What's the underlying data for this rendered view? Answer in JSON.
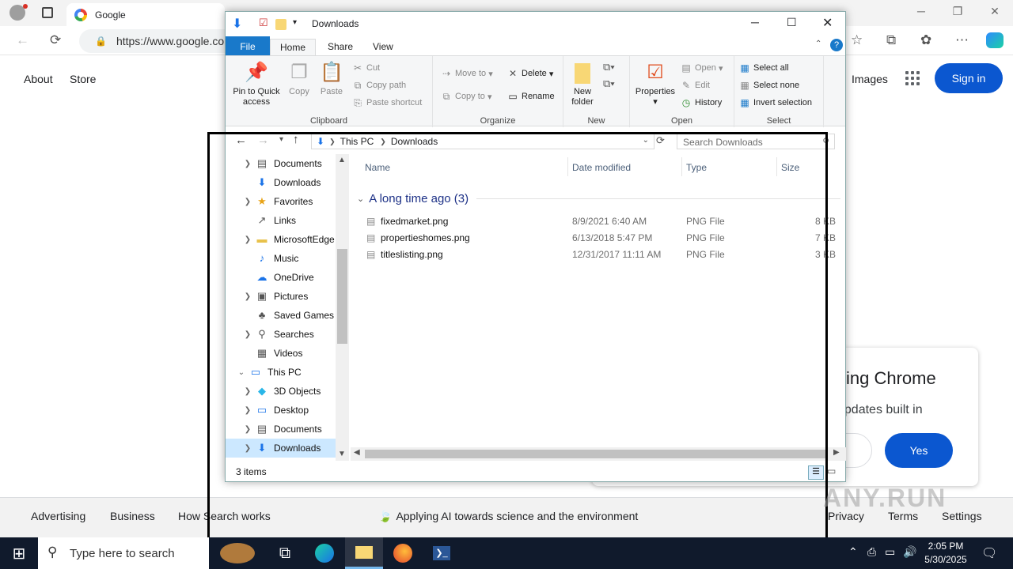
{
  "browser": {
    "tab_title": "Google",
    "address": "https://www.google.co",
    "colors": {
      "accent": "#0b57d0"
    }
  },
  "google": {
    "about": "About",
    "store": "Store",
    "images": "Images",
    "sign_in": "Sign in",
    "footer": {
      "advertising": "Advertising",
      "business": "Business",
      "how_search_works": "How Search works",
      "ai_note": "Applying AI towards science and the environment",
      "privacy": "Privacy",
      "terms": "Terms",
      "settings": "Settings"
    },
    "popup": {
      "heading": "sing Chrome",
      "sub": "updates built in",
      "yes": "Yes"
    }
  },
  "explorer": {
    "title": "Downloads",
    "ribbon_tabs": [
      "File",
      "Home",
      "Share",
      "View"
    ],
    "clipboard": {
      "pin": "Pin to Quick access",
      "copy": "Copy",
      "paste": "Paste",
      "cut": "Cut",
      "copy_path": "Copy path",
      "paste_shortcut": "Paste shortcut",
      "label": "Clipboard"
    },
    "organize": {
      "move_to": "Move to",
      "copy_to": "Copy to",
      "delete": "Delete",
      "rename": "Rename",
      "label": "Organize"
    },
    "new": {
      "new_folder": "New folder",
      "label": "New"
    },
    "open": {
      "properties": "Properties",
      "open": "Open",
      "edit": "Edit",
      "history": "History",
      "label": "Open"
    },
    "select": {
      "select_all": "Select all",
      "select_none": "Select none",
      "invert": "Invert selection",
      "label": "Select"
    },
    "breadcrumb": [
      "This PC",
      "Downloads"
    ],
    "search_placeholder": "Search Downloads",
    "nav_items": [
      {
        "label": "Documents",
        "icon": "document-icon",
        "chevron": true,
        "indent": 1
      },
      {
        "label": "Downloads",
        "icon": "download-icon",
        "chevron": false,
        "indent": 1
      },
      {
        "label": "Favorites",
        "icon": "star-icon",
        "chevron": true,
        "indent": 1
      },
      {
        "label": "Links",
        "icon": "link-icon",
        "chevron": false,
        "indent": 1
      },
      {
        "label": "MicrosoftEdge",
        "icon": "folder-icon",
        "chevron": true,
        "indent": 1
      },
      {
        "label": "Music",
        "icon": "music-icon",
        "chevron": false,
        "indent": 1
      },
      {
        "label": "OneDrive",
        "icon": "cloud-icon",
        "chevron": false,
        "indent": 1
      },
      {
        "label": "Pictures",
        "icon": "picture-icon",
        "chevron": true,
        "indent": 1
      },
      {
        "label": "Saved Games",
        "icon": "game-icon",
        "chevron": false,
        "indent": 1
      },
      {
        "label": "Searches",
        "icon": "search-icon",
        "chevron": true,
        "indent": 1
      },
      {
        "label": "Videos",
        "icon": "video-icon",
        "chevron": false,
        "indent": 1
      },
      {
        "label": "This PC",
        "icon": "computer-icon",
        "chevron": true,
        "indent": 0,
        "expanded": true
      },
      {
        "label": "3D Objects",
        "icon": "cube-icon",
        "chevron": true,
        "indent": 1
      },
      {
        "label": "Desktop",
        "icon": "desktop-icon",
        "chevron": true,
        "indent": 1
      },
      {
        "label": "Documents",
        "icon": "document-icon",
        "chevron": true,
        "indent": 1
      },
      {
        "label": "Downloads",
        "icon": "download-icon",
        "chevron": true,
        "indent": 1,
        "selected": true
      }
    ],
    "columns": [
      "Name",
      "Date modified",
      "Type",
      "Size"
    ],
    "group": "A long time ago (3)",
    "files": [
      {
        "name": "fixedmarket.png",
        "date": "8/9/2021 6:40 AM",
        "type": "PNG File",
        "size": "8 KB"
      },
      {
        "name": "propertieshomes.png",
        "date": "6/13/2018 5:47 PM",
        "type": "PNG File",
        "size": "7 KB"
      },
      {
        "name": "titleslisting.png",
        "date": "12/31/2017 11:11 AM",
        "type": "PNG File",
        "size": "3 KB"
      }
    ],
    "status": "3 items"
  },
  "taskbar": {
    "search_placeholder": "Type here to search",
    "time": "2:05 PM",
    "date": "5/30/2025"
  },
  "watermark": "ANY.RUN"
}
